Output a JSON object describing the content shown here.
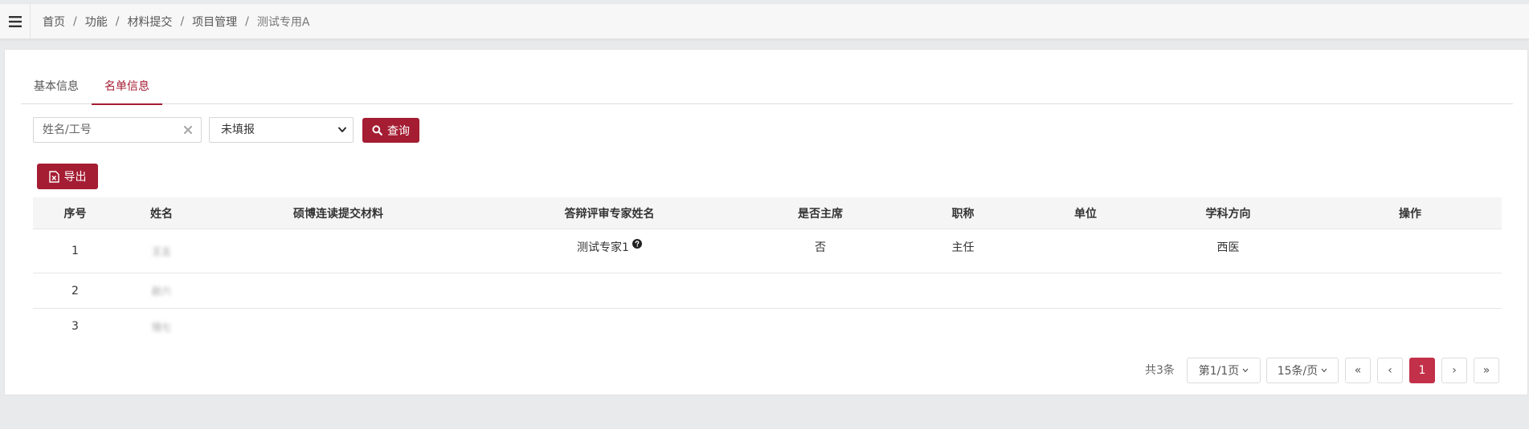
{
  "breadcrumb": [
    "首页",
    "功能",
    "材料提交",
    "项目管理",
    "测试专用A"
  ],
  "tabs": [
    {
      "label": "基本信息",
      "active": false
    },
    {
      "label": "名单信息",
      "active": true
    }
  ],
  "filters": {
    "search_placeholder": "姓名/工号",
    "search_value": "",
    "status_value": "未填报",
    "query_label": "查询",
    "export_label": "导出"
  },
  "table": {
    "columns": [
      "序号",
      "姓名",
      "硕博连读提交材料",
      "答辩评审专家姓名",
      "是否主席",
      "职称",
      "单位",
      "学科方向",
      "操作"
    ],
    "rows": [
      {
        "index": "1",
        "name": "王五",
        "materials": "",
        "expert": "测试专家1",
        "chair": "否",
        "title": "主任",
        "unit": "",
        "discipline": "西医",
        "action": ""
      },
      {
        "index": "2",
        "name": "赵六",
        "materials": "",
        "expert": "",
        "chair": "",
        "title": "",
        "unit": "",
        "discipline": "",
        "action": ""
      },
      {
        "index": "3",
        "name": "钱七",
        "materials": "",
        "expert": "",
        "chair": "",
        "title": "",
        "unit": "",
        "discipline": "",
        "action": ""
      }
    ]
  },
  "pagination": {
    "total": "共3条",
    "page_indicator": "第1/1页",
    "page_size": "15条/页",
    "first": "«",
    "prev": "‹",
    "current": "1",
    "next": "›",
    "last": "»"
  },
  "colors": {
    "accent": "#a41d33",
    "current_page": "#c2304a"
  }
}
